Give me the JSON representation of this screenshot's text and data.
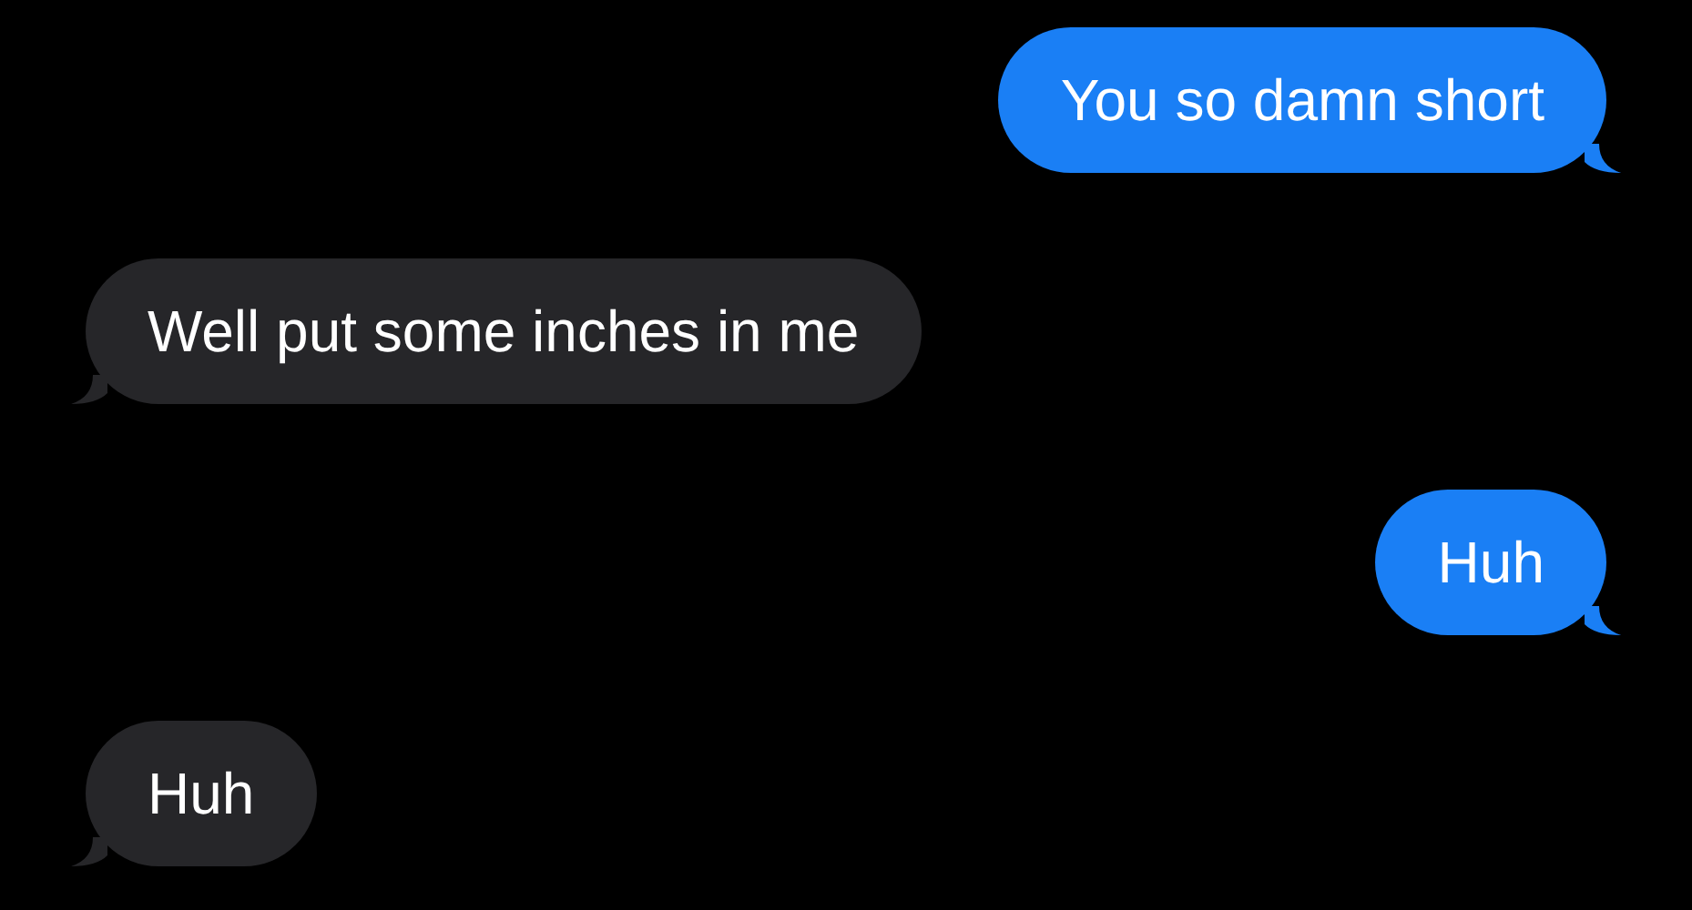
{
  "messages": [
    {
      "kind": "sent",
      "text": "You so damn short"
    },
    {
      "kind": "received",
      "text": "Well put some inches in me"
    },
    {
      "kind": "sent",
      "text": "Huh"
    },
    {
      "kind": "received",
      "text": "Huh"
    }
  ]
}
